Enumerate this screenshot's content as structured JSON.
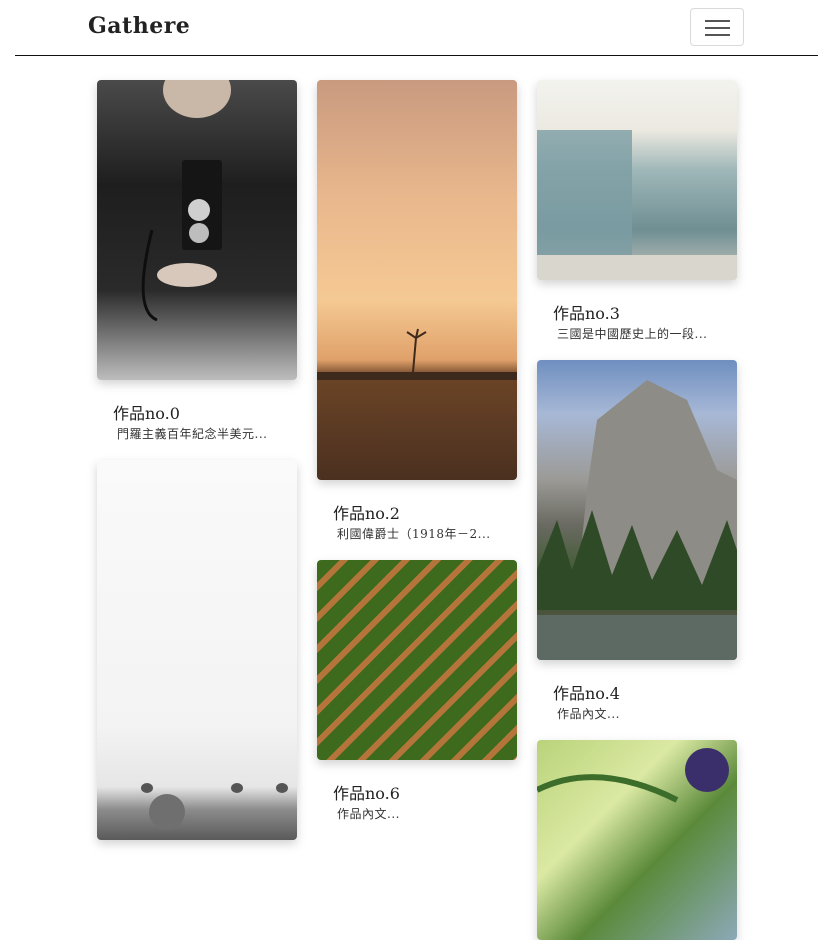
{
  "navbar": {
    "brand": "Gathere",
    "toggle_icon": "hamburger-menu-icon"
  },
  "gallery": {
    "cards": [
      {
        "title": "作品no.0",
        "desc": "門羅主義百年紀念半美元...",
        "image": "camera-photo"
      },
      {
        "title": "作品no.2",
        "desc": "利國偉爵士（1918年－2...",
        "image": "sunset-photo"
      },
      {
        "title": "作品no.3",
        "desc": "三國是中國歷史上的一段...",
        "image": "beach-building-photo"
      },
      {
        "title": "作品no.4",
        "desc": "作品內文...",
        "image": "mountain-photo"
      },
      {
        "title": "作品no.6",
        "desc": "作品內文...",
        "image": "crop-field-photo"
      },
      {
        "title": "",
        "desc": "",
        "image": "snow-field-photo"
      },
      {
        "title": "",
        "desc": "",
        "image": "leaf-photo"
      }
    ]
  }
}
